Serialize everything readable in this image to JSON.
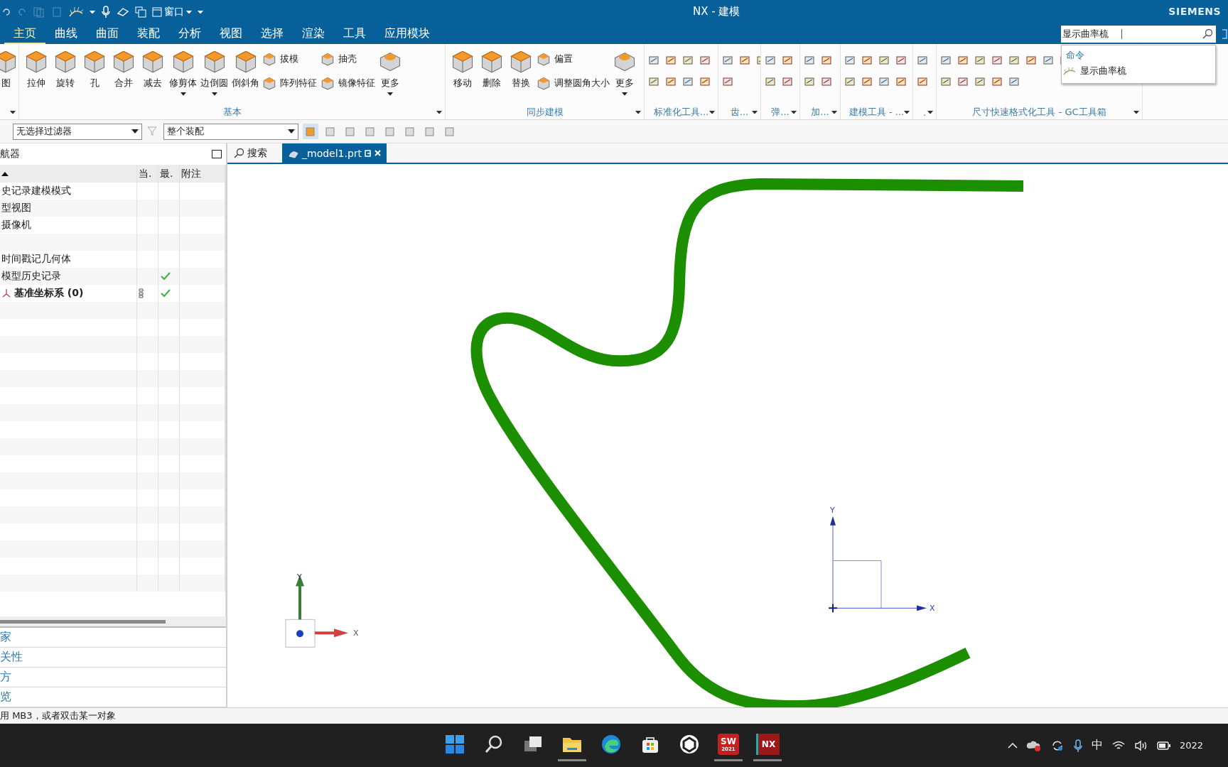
{
  "title_bar": {
    "quick_access_label": "窗口",
    "title": "NX - 建模",
    "brand": "SIEMENS"
  },
  "ribbon_tabs": [
    {
      "label": "主页",
      "selected": true
    },
    {
      "label": "曲线",
      "selected": false
    },
    {
      "label": "曲面",
      "selected": false
    },
    {
      "label": "装配",
      "selected": false
    },
    {
      "label": "分析",
      "selected": false
    },
    {
      "label": "视图",
      "selected": false
    },
    {
      "label": "选择",
      "selected": false
    },
    {
      "label": "渲染",
      "selected": false
    },
    {
      "label": "工具",
      "selected": false
    },
    {
      "label": "应用模块",
      "selected": false
    }
  ],
  "command_search": {
    "value": "显示曲率梳",
    "dropdown": {
      "heading": "命令",
      "items": [
        "显示曲率梳"
      ]
    }
  },
  "ribbon_groups": [
    {
      "kind": "buttons",
      "large": [
        {
          "label": "图",
          "menu": false
        }
      ]
    },
    {
      "kind": "buttons",
      "label": "基本",
      "large": [
        {
          "label": "拉伸",
          "menu": false
        },
        {
          "label": "旋转",
          "menu": false
        },
        {
          "label": "孔",
          "menu": false
        },
        {
          "label": "合并",
          "menu": false
        },
        {
          "label": "减去",
          "menu": false
        },
        {
          "label": "修剪体",
          "menu": true
        },
        {
          "label": "边倒圆",
          "menu": true
        },
        {
          "label": "倒斜角",
          "menu": false
        }
      ],
      "small": [
        "拔模",
        "抽壳",
        "阵列特征",
        "镜像特征"
      ],
      "more": "更多"
    },
    {
      "kind": "buttons",
      "label": "同步建模",
      "large": [
        {
          "label": "移动",
          "menu": false
        },
        {
          "label": "删除",
          "menu": false
        },
        {
          "label": "替换",
          "menu": false
        }
      ],
      "small": [
        "偏置",
        "调整圆角大小"
      ],
      "more": "更多"
    },
    {
      "kind": "icons",
      "label": "标准化工具..."
    },
    {
      "kind": "icons",
      "label": "齿..."
    },
    {
      "kind": "icons",
      "label": "弹..."
    },
    {
      "kind": "icons",
      "label": "加..."
    },
    {
      "kind": "icons",
      "label": "建模工具 - ..."
    },
    {
      "kind": "icons",
      "label": "."
    },
    {
      "kind": "icons",
      "label": "尺寸快速格式化工具 - GC工具箱"
    }
  ],
  "selection_bar": {
    "filter": "无选择过滤器",
    "scope": "整个装配"
  },
  "navigator": {
    "title": "航器",
    "columns": [
      "当.",
      "最.",
      "附注"
    ],
    "rows": [
      {
        "name": "史记录建模模式",
        "kind": "node",
        "latest": false
      },
      {
        "name": "型视图",
        "kind": "node",
        "latest": false
      },
      {
        "name": "摄像机",
        "kind": "node",
        "latest": false
      },
      {
        "name": "",
        "kind": "blank",
        "latest": false
      },
      {
        "name": "时间戳记几何体",
        "kind": "node",
        "latest": false
      },
      {
        "name": "模型历史记录",
        "kind": "node",
        "latest": true
      },
      {
        "name": "基准坐标系 (0)",
        "kind": "feature",
        "latest": true
      }
    ],
    "sections": [
      "家",
      "关性",
      "方",
      "览"
    ]
  },
  "graphics_tabs": [
    {
      "label": "搜索",
      "kind": "search",
      "selected": false
    },
    {
      "label": "_model1.prt",
      "kind": "part",
      "selected": true
    }
  ],
  "viewport": {
    "triad": {
      "x_label": "X",
      "y_label": "Y"
    },
    "datum": {
      "x_label": "X",
      "y_label": "Y"
    }
  },
  "status_bar": {
    "message": "用 MB3，或者双击某一对象"
  },
  "taskbar": {
    "apps": [
      {
        "kind": "start",
        "active": false
      },
      {
        "kind": "search",
        "active": false
      },
      {
        "kind": "taskview",
        "active": false
      },
      {
        "kind": "folder",
        "active": true
      },
      {
        "kind": "browser",
        "active": false
      },
      {
        "kind": "store",
        "active": false
      },
      {
        "kind": "ring",
        "active": false
      },
      {
        "kind": "badge",
        "label": "SW",
        "sub": "2021",
        "active": true
      },
      {
        "kind": "badge",
        "label": "NX",
        "active": true
      }
    ],
    "ime": "中",
    "clock": "2022"
  }
}
